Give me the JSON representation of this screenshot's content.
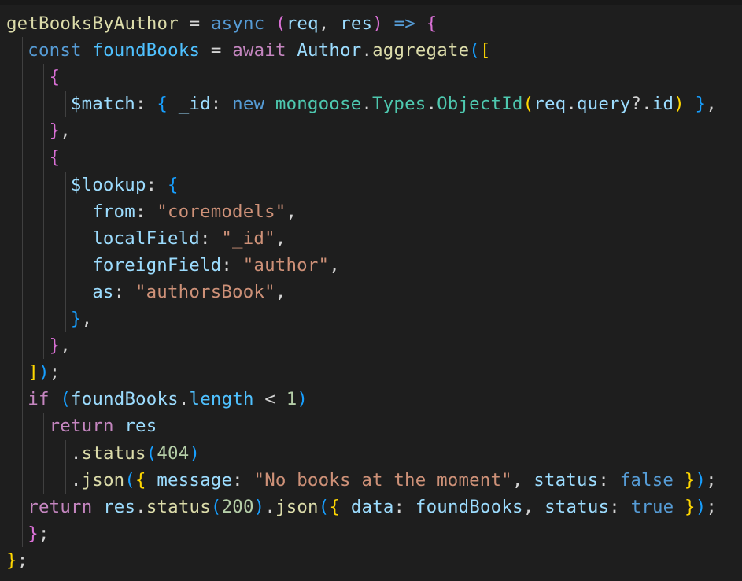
{
  "editor": {
    "language": "javascript",
    "theme_colors": {
      "background": "#1e1e1e",
      "default_text": "#d4d4d4",
      "function": "#dcdcaa",
      "variable": "#9cdcfe",
      "constant": "#4fc1ff",
      "keyword": "#569cd6",
      "control": "#c586c0",
      "string": "#ce9178",
      "number": "#b5cea8",
      "type": "#4ec9b0",
      "bracket_level_1": "#ffd700",
      "bracket_level_2": "#da70d6",
      "bracket_level_3": "#179fff"
    }
  },
  "code_lines": [
    {
      "indent": 0,
      "tokens": [
        [
          "getBooksByAuthor",
          "fn"
        ],
        [
          " = ",
          "op"
        ],
        [
          "async",
          "kw"
        ],
        [
          " ",
          "op"
        ],
        [
          "(",
          "b2"
        ],
        [
          "req",
          "var"
        ],
        [
          ", ",
          "op"
        ],
        [
          "res",
          "var"
        ],
        [
          ")",
          "b2"
        ],
        [
          " ",
          "op"
        ],
        [
          "=>",
          "kw"
        ],
        [
          " ",
          "op"
        ],
        [
          "{",
          "b2"
        ]
      ]
    },
    {
      "indent": 1,
      "tokens": [
        [
          "const",
          "kw"
        ],
        [
          " ",
          "op"
        ],
        [
          "foundBooks",
          "const"
        ],
        [
          " = ",
          "op"
        ],
        [
          "await",
          "ctl"
        ],
        [
          " ",
          "op"
        ],
        [
          "Author",
          "var"
        ],
        [
          ".",
          "op"
        ],
        [
          "aggregate",
          "fn"
        ],
        [
          "(",
          "b3"
        ],
        [
          "[",
          "b1"
        ]
      ]
    },
    {
      "indent": 2,
      "tokens": [
        [
          "{",
          "b2"
        ]
      ]
    },
    {
      "indent": 3,
      "tokens": [
        [
          "$match",
          "var"
        ],
        [
          ": ",
          "op"
        ],
        [
          "{",
          "b3"
        ],
        [
          " ",
          "op"
        ],
        [
          "_id",
          "var"
        ],
        [
          ": ",
          "op"
        ],
        [
          "new",
          "kw"
        ],
        [
          " ",
          "op"
        ],
        [
          "mongoose",
          "type"
        ],
        [
          ".",
          "op"
        ],
        [
          "Types",
          "type"
        ],
        [
          ".",
          "op"
        ],
        [
          "ObjectId",
          "type"
        ],
        [
          "(",
          "b1"
        ],
        [
          "req",
          "var"
        ],
        [
          ".",
          "op"
        ],
        [
          "query",
          "var"
        ],
        [
          "?.",
          "op"
        ],
        [
          "id",
          "var"
        ],
        [
          ")",
          "b1"
        ],
        [
          " ",
          "op"
        ],
        [
          "}",
          "b3"
        ],
        [
          ",",
          "op"
        ]
      ]
    },
    {
      "indent": 2,
      "tokens": [
        [
          "}",
          "b2"
        ],
        [
          ",",
          "op"
        ]
      ]
    },
    {
      "indent": 2,
      "tokens": [
        [
          "{",
          "b2"
        ]
      ]
    },
    {
      "indent": 3,
      "tokens": [
        [
          "$lookup",
          "var"
        ],
        [
          ": ",
          "op"
        ],
        [
          "{",
          "b3"
        ]
      ]
    },
    {
      "indent": 4,
      "tokens": [
        [
          "from",
          "var"
        ],
        [
          ": ",
          "op"
        ],
        [
          "\"coremodels\"",
          "str"
        ],
        [
          ",",
          "op"
        ]
      ]
    },
    {
      "indent": 4,
      "tokens": [
        [
          "localField",
          "var"
        ],
        [
          ": ",
          "op"
        ],
        [
          "\"_id\"",
          "str"
        ],
        [
          ",",
          "op"
        ]
      ]
    },
    {
      "indent": 4,
      "tokens": [
        [
          "foreignField",
          "var"
        ],
        [
          ": ",
          "op"
        ],
        [
          "\"author\"",
          "str"
        ],
        [
          ",",
          "op"
        ]
      ]
    },
    {
      "indent": 4,
      "tokens": [
        [
          "as",
          "var"
        ],
        [
          ": ",
          "op"
        ],
        [
          "\"authorsBook\"",
          "str"
        ],
        [
          ",",
          "op"
        ]
      ]
    },
    {
      "indent": 3,
      "tokens": [
        [
          "}",
          "b3"
        ],
        [
          ",",
          "op"
        ]
      ]
    },
    {
      "indent": 2,
      "tokens": [
        [
          "}",
          "b2"
        ],
        [
          ",",
          "op"
        ]
      ]
    },
    {
      "indent": 1,
      "tokens": [
        [
          "]",
          "b1"
        ],
        [
          ")",
          "b3"
        ],
        [
          ";",
          "op"
        ]
      ]
    },
    {
      "indent": 1,
      "tokens": [
        [
          "if",
          "ctl"
        ],
        [
          " ",
          "op"
        ],
        [
          "(",
          "b3"
        ],
        [
          "foundBooks",
          "var"
        ],
        [
          ".",
          "op"
        ],
        [
          "length",
          "const"
        ],
        [
          " < ",
          "op"
        ],
        [
          "1",
          "num"
        ],
        [
          ")",
          "b3"
        ]
      ]
    },
    {
      "indent": 2,
      "tokens": [
        [
          "return",
          "ctl"
        ],
        [
          " ",
          "op"
        ],
        [
          "res",
          "var"
        ]
      ]
    },
    {
      "indent": 3,
      "tokens": [
        [
          ".",
          "op"
        ],
        [
          "status",
          "fn"
        ],
        [
          "(",
          "b3"
        ],
        [
          "404",
          "num"
        ],
        [
          ")",
          "b3"
        ]
      ]
    },
    {
      "indent": 3,
      "tokens": [
        [
          ".",
          "op"
        ],
        [
          "json",
          "fn"
        ],
        [
          "(",
          "b3"
        ],
        [
          "{",
          "b1"
        ],
        [
          " ",
          "op"
        ],
        [
          "message",
          "var"
        ],
        [
          ": ",
          "op"
        ],
        [
          "\"No books at the moment\"",
          "str"
        ],
        [
          ", ",
          "op"
        ],
        [
          "status",
          "var"
        ],
        [
          ": ",
          "op"
        ],
        [
          "false",
          "kw"
        ],
        [
          " ",
          "op"
        ],
        [
          "}",
          "b1"
        ],
        [
          ")",
          "b3"
        ],
        [
          ";",
          "op"
        ]
      ]
    },
    {
      "indent": 1,
      "tokens": [
        [
          "return",
          "ctl"
        ],
        [
          " ",
          "op"
        ],
        [
          "res",
          "var"
        ],
        [
          ".",
          "op"
        ],
        [
          "status",
          "fn"
        ],
        [
          "(",
          "b3"
        ],
        [
          "200",
          "num"
        ],
        [
          ")",
          "b3"
        ],
        [
          ".",
          "op"
        ],
        [
          "json",
          "fn"
        ],
        [
          "(",
          "b3"
        ],
        [
          "{",
          "b1"
        ],
        [
          " ",
          "op"
        ],
        [
          "data",
          "var"
        ],
        [
          ": ",
          "op"
        ],
        [
          "foundBooks",
          "var"
        ],
        [
          ", ",
          "op"
        ],
        [
          "status",
          "var"
        ],
        [
          ": ",
          "op"
        ],
        [
          "true",
          "kw"
        ],
        [
          " ",
          "op"
        ],
        [
          "}",
          "b1"
        ],
        [
          ")",
          "b3"
        ],
        [
          ";",
          "op"
        ]
      ]
    },
    {
      "indent": 1,
      "tokens": [
        [
          "}",
          "b2"
        ],
        [
          ";",
          "op"
        ]
      ]
    },
    {
      "indent": 0,
      "tokens": [
        [
          "}",
          "b1"
        ],
        [
          ";",
          "op"
        ]
      ]
    }
  ]
}
